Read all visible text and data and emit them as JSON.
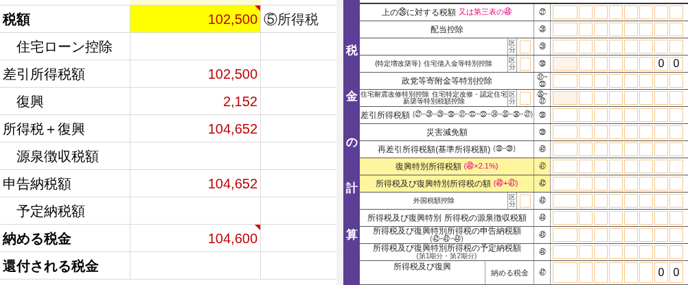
{
  "sheet": {
    "rows": [
      {
        "label": "税額",
        "bold": true,
        "indented": false,
        "value": "102,500",
        "highlighted": true,
        "has_comment": true,
        "note": "⑤所得税"
      },
      {
        "label": "住宅ローン控除",
        "bold": false,
        "indented": true,
        "highlighted": false,
        "has_comment": false
      },
      {
        "label": "差引所得税額",
        "bold": false,
        "indented": false,
        "value": "102,500",
        "highlighted": false,
        "has_comment": false
      },
      {
        "label": "復興",
        "bold": false,
        "indented": true,
        "value": "2,152",
        "highlighted": false,
        "has_comment": false
      },
      {
        "label": "所得税＋復興",
        "bold": false,
        "indented": false,
        "value": "104,652",
        "highlighted": false,
        "has_comment": false
      },
      {
        "label": "源泉徴収税額",
        "bold": false,
        "indented": true,
        "highlighted": false,
        "has_comment": false
      },
      {
        "label": "申告納税額",
        "bold": false,
        "indented": false,
        "value": "104,652",
        "highlighted": false,
        "has_comment": false
      },
      {
        "label": "予定納税額",
        "bold": false,
        "indented": true,
        "highlighted": false,
        "has_comment": false
      },
      {
        "label": "納める税金",
        "bold": true,
        "indented": false,
        "value": "104,600",
        "highlighted": false,
        "has_comment": true
      },
      {
        "label": "還付される税金",
        "bold": true,
        "indented": false,
        "highlighted": false,
        "has_comment": false
      }
    ]
  },
  "form": {
    "section_label": [
      "税",
      "金",
      "の",
      "計",
      "算"
    ],
    "rows": [
      {
        "kind": "plain",
        "number": "㉗",
        "highlighted": false,
        "first_box_shaded": false,
        "lines": [
          {
            "text": "上の㉖に対する税額",
            "kind": "main"
          },
          {
            "text": "又は第三表の㊽",
            "kind": "note"
          }
        ]
      },
      {
        "kind": "plain",
        "number": "㉘",
        "highlighted": false,
        "first_box_shaded": false,
        "lines": [
          {
            "text": "配当控除",
            "kind": "main"
          }
        ]
      },
      {
        "kind": "kubun",
        "number": "㉙",
        "highlighted": false,
        "first_box_shaded": false,
        "kubun": "区分"
      },
      {
        "kind": "kubun",
        "number": "㉚",
        "highlighted": false,
        "first_box_shaded": true,
        "kubun": "区分",
        "lines": [
          {
            "text": "(特定増改築等)",
            "kind": "main"
          },
          {
            "text": "住宅借入金等特別控除",
            "kind": "main"
          }
        ],
        "digits": [
          "0",
          "0"
        ]
      },
      {
        "kind": "plain",
        "number": "㉛~㉝",
        "highlighted": false,
        "first_box_shaded": false,
        "lines": [
          {
            "text": "政党等寄附金等特別控除",
            "kind": "main"
          }
        ]
      },
      {
        "kind": "kubun",
        "number": "㉟~㊲",
        "highlighted": false,
        "first_box_shaded": true,
        "kubun": "区分",
        "lines": [
          {
            "text": "住宅耐震改修特別控除",
            "kind": "main"
          },
          {
            "text": "住宅特定改修・認定住宅",
            "kind": "main"
          },
          {
            "text": "新築等特別税額控除",
            "kind": "main"
          }
        ]
      },
      {
        "kind": "plain",
        "number": "㊳",
        "highlighted": false,
        "first_box_shaded": false,
        "lines": [
          {
            "text": "差引所得税額",
            "kind": "main"
          },
          {
            "text": "(㉗−㉘−㉙−㉚−㉛−㉜−㉝−㉞−㉟−㊱−㊲)",
            "kind": "formula"
          }
        ]
      },
      {
        "kind": "plain",
        "number": "㊴",
        "highlighted": false,
        "first_box_shaded": false,
        "lines": [
          {
            "text": "災害減免額",
            "kind": "main"
          }
        ]
      },
      {
        "kind": "plain",
        "number": "㊵",
        "highlighted": false,
        "first_box_shaded": false,
        "lines": [
          {
            "text": "再差引所得税額(基準所得税額)",
            "kind": "main"
          },
          {
            "text": "(㊳−㊴)",
            "kind": "formula"
          }
        ]
      },
      {
        "kind": "plain",
        "number": "㊶",
        "highlighted": true,
        "first_box_shaded": false,
        "lines": [
          {
            "text": "復興特別所得税額",
            "kind": "main"
          },
          {
            "text": "(㊵×2.1%)",
            "kind": "note"
          }
        ]
      },
      {
        "kind": "plain",
        "number": "㊷",
        "highlighted": true,
        "first_box_shaded": false,
        "lines": [
          {
            "text": "所得税及び復興特別所得税の額",
            "kind": "main"
          },
          {
            "text": "(㊵+㊶)",
            "kind": "note"
          }
        ]
      },
      {
        "kind": "kubun",
        "number": "㊸",
        "highlighted": false,
        "first_box_shaded": false,
        "kubun": "区分",
        "lines": [
          {
            "text": "外国税額控除",
            "kind": "main"
          }
        ]
      },
      {
        "kind": "plain",
        "number": "㊹",
        "highlighted": false,
        "first_box_shaded": false,
        "lines": [
          {
            "text": "所得税及び復興特別",
            "kind": "main"
          },
          {
            "text": "所得税の源泉徴収税額",
            "kind": "main"
          }
        ]
      },
      {
        "kind": "plain",
        "number": "㊺",
        "highlighted": false,
        "first_box_shaded": false,
        "lines": [
          {
            "text": "所得税及び復興特別所得税の申告納税額",
            "kind": "main"
          },
          {
            "text": "(㊷−㊸−㊹)",
            "kind": "formula"
          }
        ]
      },
      {
        "kind": "plain",
        "number": "㊻",
        "highlighted": false,
        "first_box_shaded": false,
        "lines": [
          {
            "text": "所得税及び復興特別所得税の予定納税額",
            "kind": "main"
          },
          {
            "text": "(第1期分・第2期分)",
            "kind": "formula"
          }
        ]
      },
      {
        "kind": "split",
        "number": "㊼",
        "highlighted": false,
        "first_box_shaded": false,
        "lines": [
          {
            "text": "所得税及び復興",
            "kind": "main"
          }
        ],
        "sub_label": "納める税金",
        "digits": [
          "0",
          "0"
        ]
      }
    ]
  }
}
